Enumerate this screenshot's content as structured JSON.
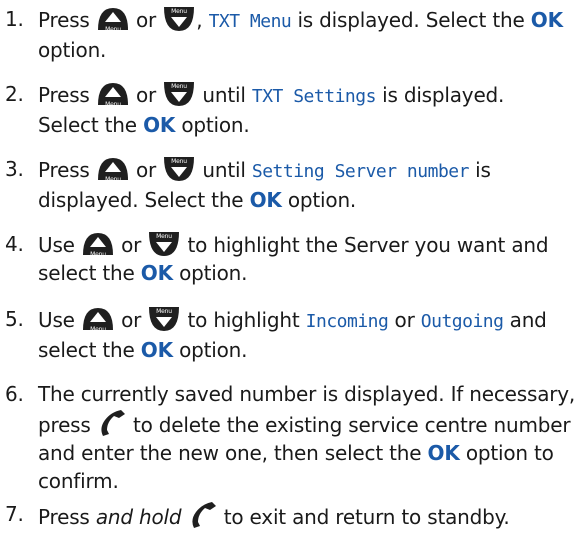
{
  "icons": {
    "up_button": "menu-up-button-icon",
    "down_button": "menu-down-button-icon",
    "cancel_button": "cancel-phone-button-icon",
    "up_label": "Menu",
    "down_label": "Menu"
  },
  "steps": [
    {
      "num": "1.",
      "a": "Press",
      "or": "or",
      "b": ",",
      "disp1": "TXT Menu",
      "c": "is displayed. Select the",
      "ok": "OK",
      "d": "option."
    },
    {
      "num": "2.",
      "a": "Press",
      "or": "or",
      "b": "until",
      "disp1": "TXT Settings",
      "c": "is displayed.",
      "c2": "Select the",
      "ok": "OK",
      "d": "option."
    },
    {
      "num": "3.",
      "a": "Press",
      "or": "or",
      "b": "until",
      "disp1": "Setting Server number",
      "c": "is displayed. Select the",
      "ok": "OK",
      "d": "option."
    },
    {
      "num": "4.",
      "a": "Use",
      "or": "or",
      "b": "to highlight the Server you want and select the",
      "ok": "OK",
      "d": "option."
    },
    {
      "num": "5.",
      "a": "Use",
      "or": "or",
      "b": "to highlight",
      "disp1": "Incoming",
      "or2": "or",
      "disp2": "Outgoing",
      "c": "and select the",
      "ok": "OK",
      "d": "option."
    },
    {
      "num": "6.",
      "a": "The currently saved number is displayed. If necessary, press",
      "b": "to delete the existing service centre number and enter the new one, then select the",
      "ok": "OK",
      "d": "option to confirm."
    },
    {
      "num": "7.",
      "a": "Press",
      "em": "and hold",
      "b": "to exit and return to standby."
    }
  ]
}
